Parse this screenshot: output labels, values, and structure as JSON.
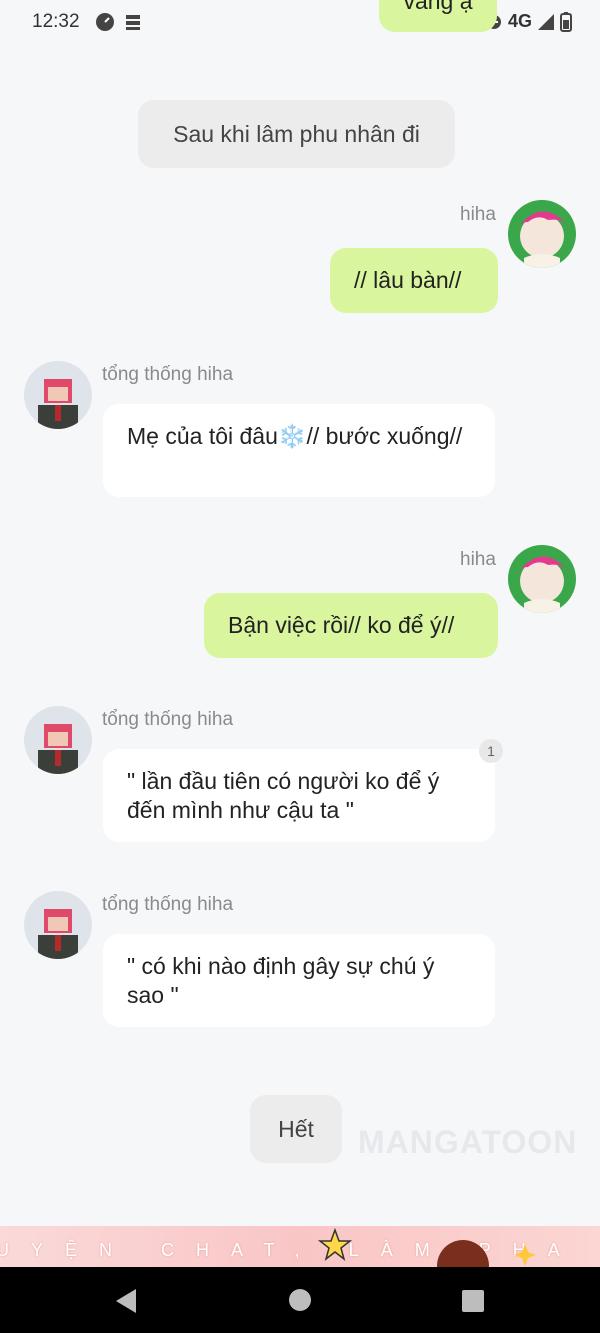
{
  "status_bar": {
    "time": "12:32",
    "network": "4G"
  },
  "top_partial_bubble": {
    "text": "vâng ạ"
  },
  "messages": [
    {
      "type": "narration",
      "text": "Sau khi lâm phu nhân đi"
    },
    {
      "type": "me",
      "name": "hiha",
      "text": "// lâu bàn//"
    },
    {
      "type": "other",
      "name": "tổng thống hiha",
      "text": "Mẹ của tôi đâu❄️// bước xuống//"
    },
    {
      "type": "me",
      "name": "hiha",
      "text": "Bận việc rồi// ko để ý//"
    },
    {
      "type": "other",
      "name": "tổng thống hiha",
      "text": "\" lần đầu tiên có người ko để ý đến mình như cậu ta \"",
      "badge": "1"
    },
    {
      "type": "other",
      "name": "tổng thống hiha",
      "text": "\" có khi nào định gây sự chú ý sao \""
    },
    {
      "type": "narration",
      "text": "Hết"
    }
  ],
  "watermark": "MANGATOON",
  "banner": {
    "text": "UYỆN CHAT, LÀM PHA"
  },
  "colors": {
    "my_bubble": "#d9f59d",
    "other_bubble": "#ffffff",
    "narration": "#ececec",
    "background": "#f6f7f9"
  }
}
